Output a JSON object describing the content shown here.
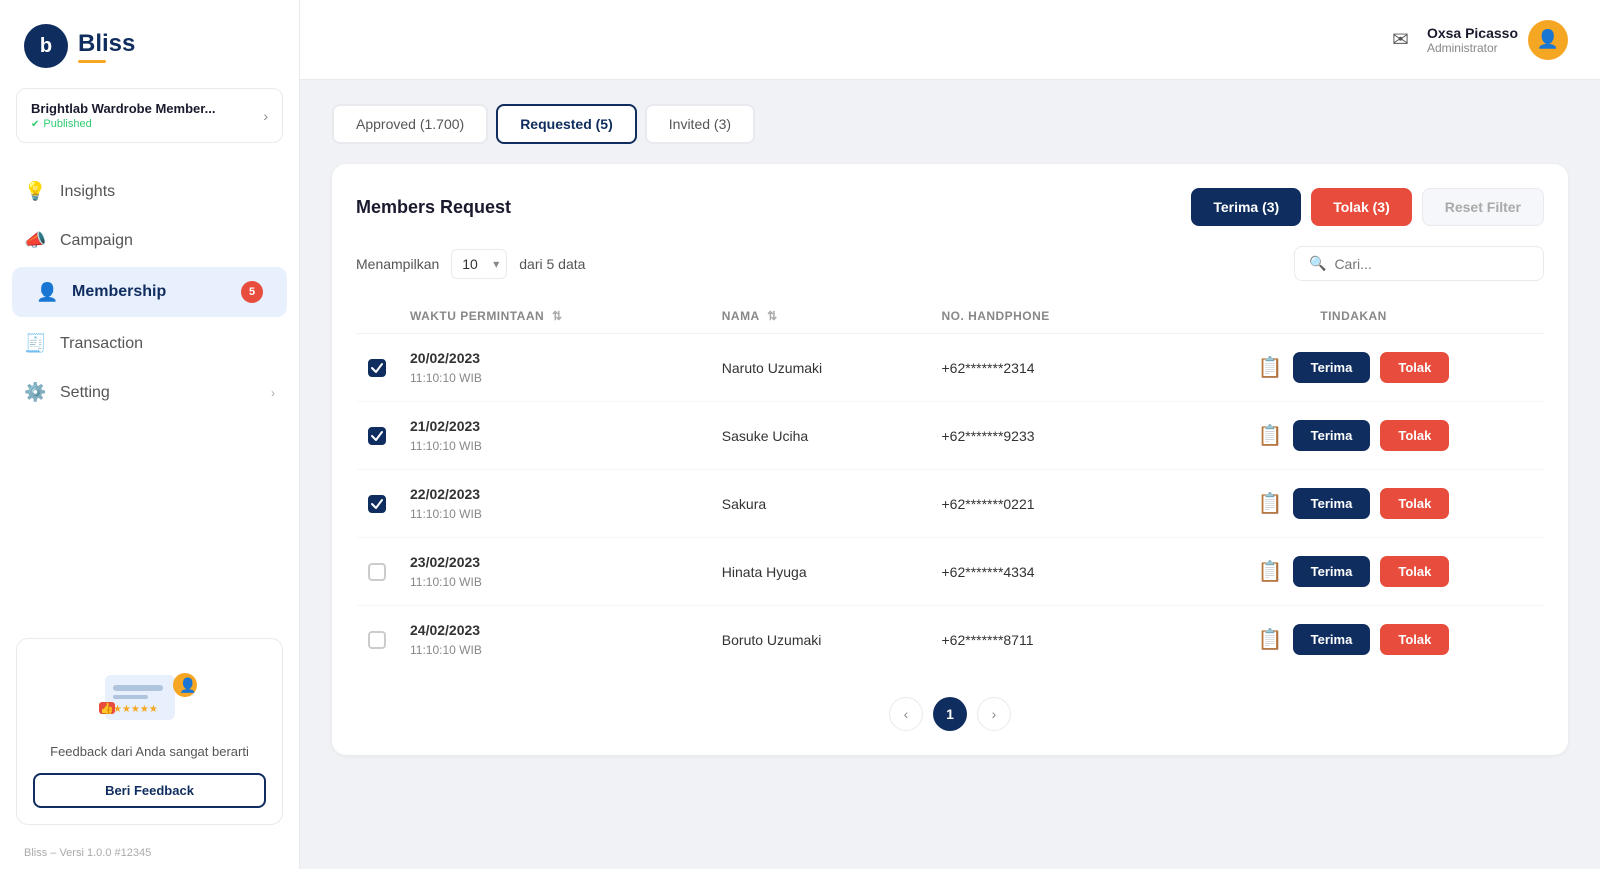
{
  "sidebar": {
    "logo": {
      "icon": "b",
      "name": "Bliss"
    },
    "workspace": {
      "name": "Brightlab Wardrobe Member...",
      "status": "Published"
    },
    "nav_items": [
      {
        "id": "insights",
        "label": "Insights",
        "icon": "💡",
        "active": false,
        "badge": null
      },
      {
        "id": "campaign",
        "label": "Campaign",
        "icon": "📣",
        "active": false,
        "badge": null
      },
      {
        "id": "membership",
        "label": "Membership",
        "icon": "👤",
        "active": true,
        "badge": 5
      },
      {
        "id": "transaction",
        "label": "Transaction",
        "icon": "🧾",
        "active": false,
        "badge": null
      },
      {
        "id": "setting",
        "label": "Setting",
        "icon": "⚙️",
        "active": false,
        "badge": null,
        "has_chevron": true
      }
    ],
    "feedback": {
      "text": "Feedback dari Anda sangat berarti",
      "button_label": "Beri Feedback"
    },
    "version": "Bliss – Versi 1.0.0 #12345"
  },
  "topbar": {
    "user": {
      "name": "Oxsa Picasso",
      "role": "Administrator"
    }
  },
  "tabs": [
    {
      "id": "approved",
      "label": "Approved (1.700)",
      "active": false
    },
    {
      "id": "requested",
      "label": "Requested (5)",
      "active": true
    },
    {
      "id": "invited",
      "label": "Invited (3)",
      "active": false
    }
  ],
  "table_section": {
    "title": "Members Request",
    "btn_terima": "Terima (3)",
    "btn_tolak": "Tolak (3)",
    "btn_reset": "Reset Filter",
    "showing_label": "Menampilkan",
    "per_page": "10",
    "from_label": "dari 5 data",
    "search_placeholder": "Cari...",
    "columns": [
      {
        "id": "check",
        "label": ""
      },
      {
        "id": "waktu",
        "label": "WAKTU PERMINTAAN"
      },
      {
        "id": "nama",
        "label": "NAMA"
      },
      {
        "id": "phone",
        "label": "NO. HANDPHONE"
      },
      {
        "id": "action",
        "label": "TINDAKAN"
      }
    ],
    "rows": [
      {
        "id": 1,
        "checked": true,
        "date": "20/02/2023",
        "time": "11:10:10 WIB",
        "name": "Naruto Uzumaki",
        "phone": "+62*******2314"
      },
      {
        "id": 2,
        "checked": true,
        "date": "21/02/2023",
        "time": "11:10:10 WIB",
        "name": "Sasuke Uciha",
        "phone": "+62*******9233"
      },
      {
        "id": 3,
        "checked": true,
        "date": "22/02/2023",
        "time": "11:10:10 WIB",
        "name": "Sakura",
        "phone": "+62*******0221"
      },
      {
        "id": 4,
        "checked": false,
        "date": "23/02/2023",
        "time": "11:10:10 WIB",
        "name": "Hinata Hyuga",
        "phone": "+62*******4334"
      },
      {
        "id": 5,
        "checked": false,
        "date": "24/02/2023",
        "time": "11:10:10 WIB",
        "name": "Boruto Uzumaki",
        "phone": "+62*******8711"
      }
    ],
    "pagination": {
      "current_page": 1,
      "total_pages": 1
    },
    "row_actions": {
      "terima": "Terima",
      "tolak": "Tolak"
    }
  }
}
